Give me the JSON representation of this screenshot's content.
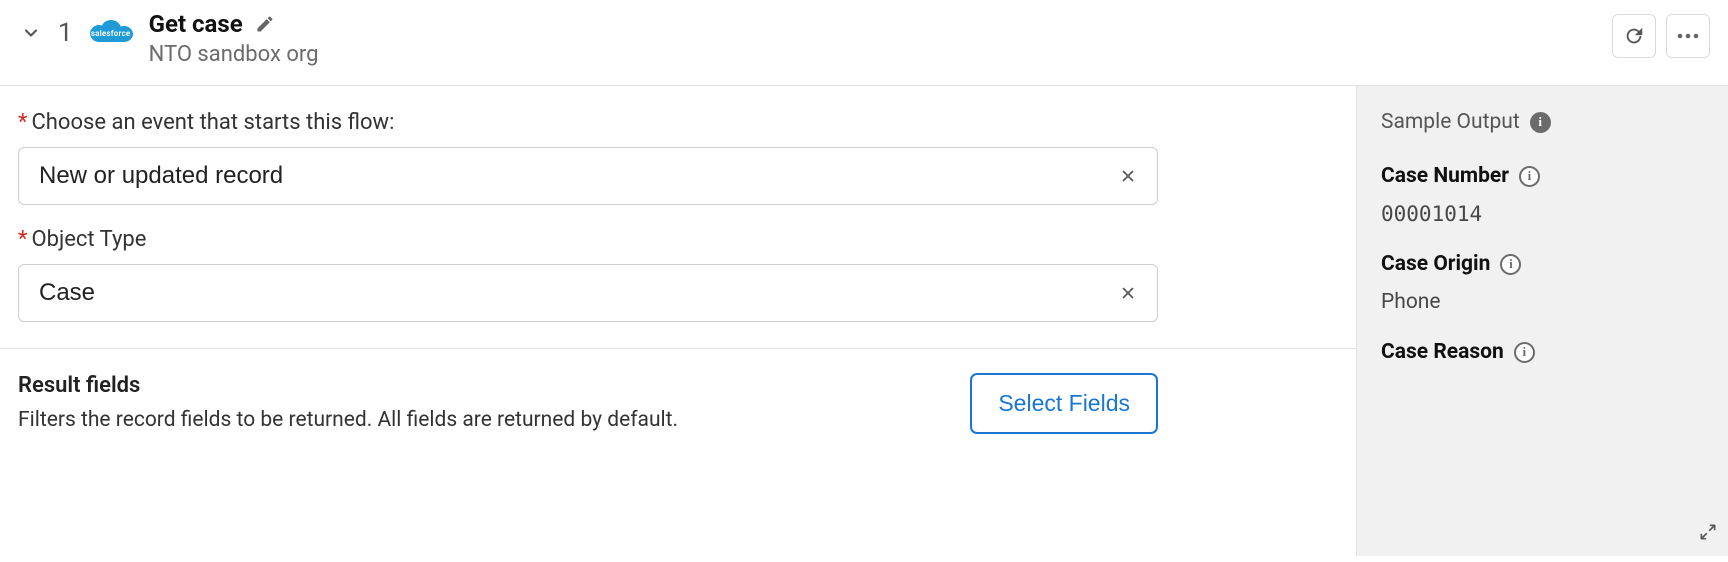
{
  "header": {
    "step_number": "1",
    "title": "Get case",
    "subtitle": "NTO sandbox org",
    "logo_label": "salesforce"
  },
  "form": {
    "event_label": "Choose an event that starts this flow:",
    "event_value": "New or updated record",
    "object_label": "Object Type",
    "object_value": "Case"
  },
  "result": {
    "title": "Result fields",
    "description": "Filters the record fields to be returned. All fields are returned by default.",
    "button_label": "Select Fields"
  },
  "side": {
    "heading": "Sample Output",
    "items": [
      {
        "label": "Case Number",
        "value": "00001014",
        "mono": true
      },
      {
        "label": "Case Origin",
        "value": "Phone",
        "mono": false
      },
      {
        "label": "Case Reason",
        "value": "",
        "mono": false
      }
    ]
  }
}
